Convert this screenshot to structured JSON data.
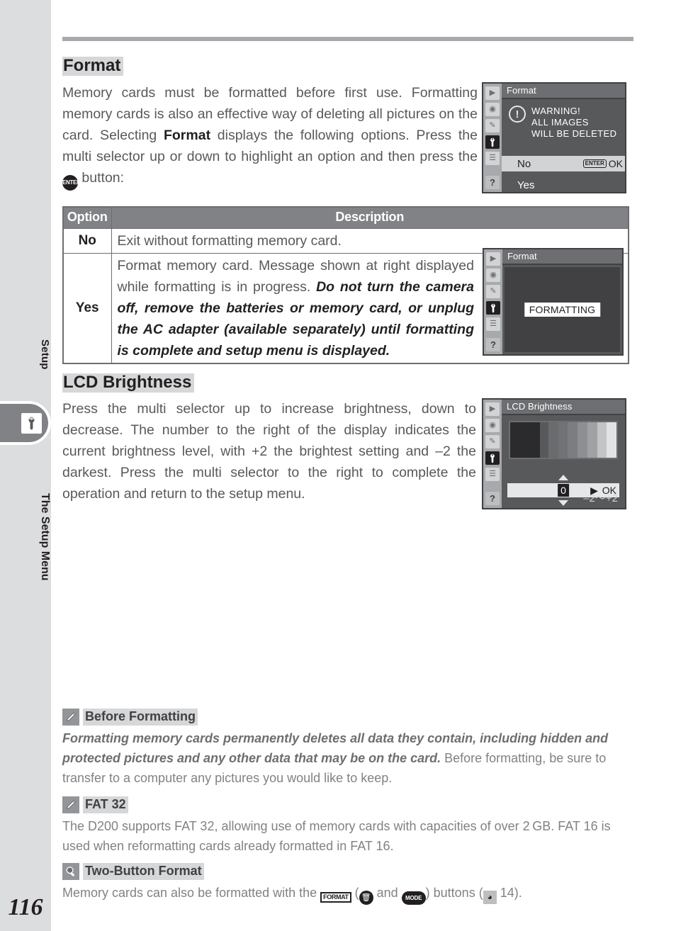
{
  "page": {
    "number": "116",
    "edge_label_top": "Setup",
    "edge_label_main": "The Setup Menu",
    "tab_icon": "wrench-icon"
  },
  "format_section": {
    "heading": "Format",
    "body_part1": "Memory cards must be formatted before first use.  Formatting memory cards is also an effective way of deleting all pictures on the card.  Selecting ",
    "body_bold": "Format",
    "body_part2": " displays the following options.  Press the multi selector up or down to highlight an option and then press the ",
    "enter_badge": "ENTER",
    "body_part3": " button:"
  },
  "format_lcd": {
    "title": "Format",
    "warning_lines": "WARNING!\nALL IMAGES\nWILL BE DELETED",
    "warning_line1": "WARNING!",
    "warning_line2": "ALL IMAGES",
    "warning_line3": "WILL BE DELETED",
    "bang": "!",
    "option_no": "No",
    "enter_pill": "ENTER",
    "ok": "OK",
    "option_yes": "Yes",
    "rail_icons": [
      "playback-icon",
      "shooting-menu-icon",
      "custom-settings-icon",
      "setup-menu-icon",
      "recent-settings-icon",
      "help-icon"
    ]
  },
  "table": {
    "headers": [
      "Option",
      "Description"
    ],
    "rows": [
      {
        "option": "No",
        "description": "Exit without formatting memory card."
      },
      {
        "option": "Yes",
        "description_plain1": "Format memory card.  Message shown at right displayed while formatting is in progress.  ",
        "description_italic": "Do not turn the camera off, remove the batteries or memory card, or unplug the AC adapter (available separately) until formatting is complete and setup menu is displayed."
      }
    ]
  },
  "formatting_lcd": {
    "title": "Format",
    "message": "FORMATTING"
  },
  "lcd_section": {
    "heading": "LCD Brightness",
    "body": "Press the multi selector up to increase brightness, down to decrease.  The number to the right of the display indicates the current brightness level, with +2 the brightest setting and –2 the darkest.  Press the multi selector to the right to complete the operation and return to the setup menu."
  },
  "brightness_lcd": {
    "title": "LCD Brightness",
    "value": "0",
    "ok": "OK",
    "range": "–2～+2",
    "gradient_steps": [
      "#6a6b6e",
      "#717275",
      "#7c7d80",
      "#8e8f92",
      "#a0a1a4",
      "#c3c4c6",
      "#e2e3e4"
    ],
    "dark_block": "#2b2b2d"
  },
  "notes": [
    {
      "icon": "pencil-icon",
      "title": "Before Formatting",
      "italic_text": "Formatting memory cards permanently deletes all data they contain, including hidden and protected pictures and any other data that may be on the card.",
      "plain_text": "  Before formatting, be sure to transfer to a computer any pictures you would like to keep."
    },
    {
      "icon": "pencil-icon",
      "title": "FAT 32",
      "plain_text": "The D200 supports FAT 32, allowing use of memory cards with capacities of over 2 GB.  FAT 16 is used when reformatting cards already formatted in FAT 16."
    },
    {
      "icon": "magnifier-icon",
      "title": "Two-Button Format",
      "text_before": "Memory cards can also be formatted with the ",
      "btn_format_label": "FORMAT",
      "text_mid1": " (",
      "btn_trash_label": "🗑",
      "text_mid2": " and ",
      "btn_mode_label": "MODE",
      "text_mid3": ") buttons (",
      "ref_page": "14",
      "text_after": ")."
    }
  ],
  "colors": {
    "heading_highlight": "#d6d7d9",
    "rule": "#a7a9ac",
    "edge_bg": "#dcdddf",
    "tab_bg": "#808285",
    "body_text": "#58595b",
    "note_text": "#808285"
  }
}
